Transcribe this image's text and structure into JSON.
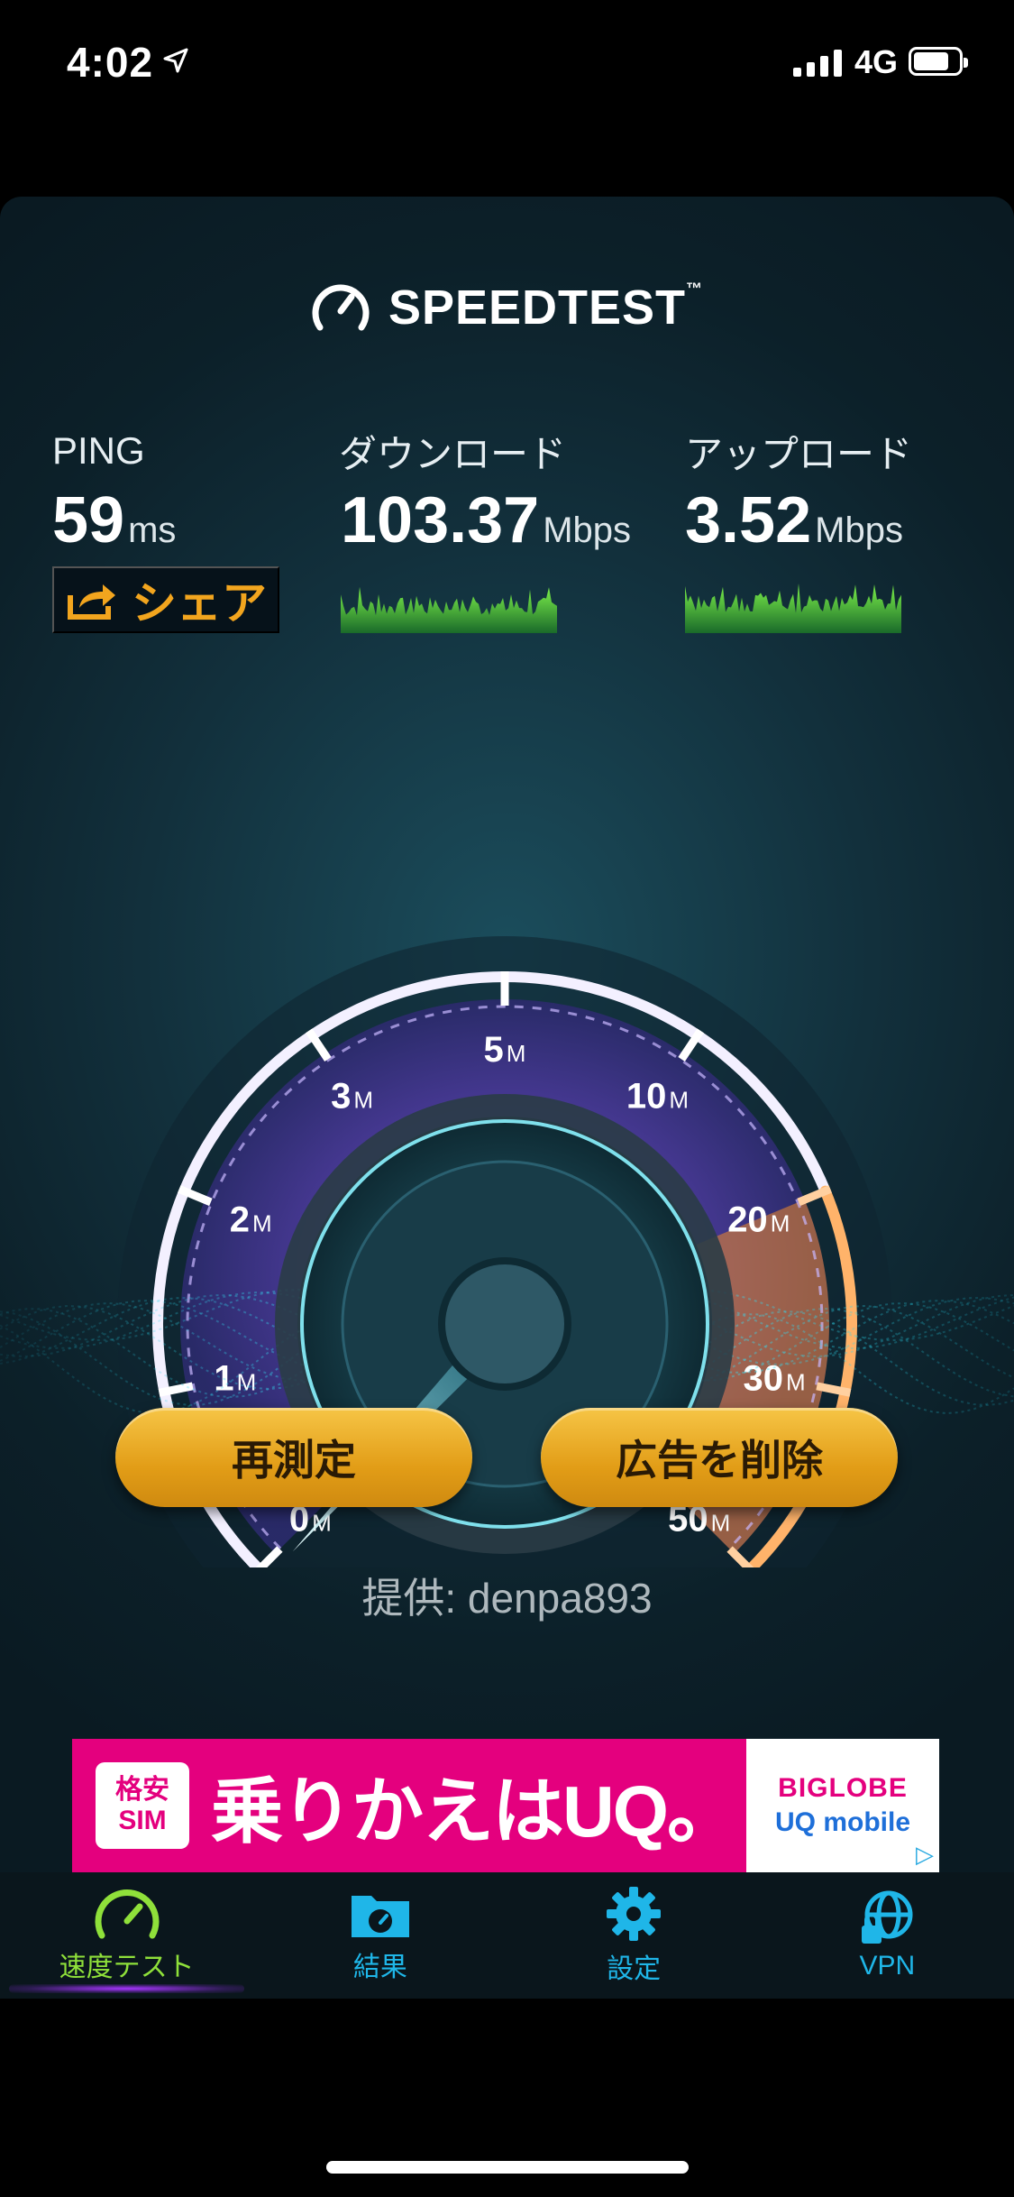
{
  "status_bar": {
    "time": "4:02",
    "network": "4G"
  },
  "app": {
    "brand": "SPEEDTEST",
    "trademark": "™"
  },
  "metrics": {
    "ping": {
      "label": "PING",
      "value": "59",
      "unit": "ms"
    },
    "download": {
      "label": "ダウンロード",
      "value": "103.37",
      "unit": "Mbps"
    },
    "upload": {
      "label": "アップロード",
      "value": "3.52",
      "unit": "Mbps"
    }
  },
  "share_label": "シェア",
  "gauge": {
    "ticks": [
      {
        "num": "0",
        "unit": "M"
      },
      {
        "num": "1",
        "unit": "M"
      },
      {
        "num": "2",
        "unit": "M"
      },
      {
        "num": "3",
        "unit": "M"
      },
      {
        "num": "5",
        "unit": "M"
      },
      {
        "num": "10",
        "unit": "M"
      },
      {
        "num": "20",
        "unit": "M"
      },
      {
        "num": "30",
        "unit": "M"
      },
      {
        "num": "50",
        "unit": "M"
      }
    ],
    "needle_value_mbps": 0,
    "colors": {
      "arc_start": "#3a6cf0",
      "arc_mid": "#8e4fe8",
      "arc_end": "#f08a2a",
      "needle": "#9ff4ff"
    }
  },
  "buttons": {
    "retest": "再測定",
    "remove_ads": "広告を削除"
  },
  "provider": "提供: denpa893",
  "ad": {
    "badge_line1": "格安",
    "badge_line2": "SIM",
    "headline": "乗りかえはUQ。",
    "brand_line1": "BIGLOBE",
    "brand_line2": "UQ mobile",
    "bg_color": "#e4007e"
  },
  "tabs": [
    {
      "label": "速度テスト",
      "icon": "speedometer-icon",
      "active": true
    },
    {
      "label": "結果",
      "icon": "results-folder-icon",
      "active": false
    },
    {
      "label": "設定",
      "icon": "gear-icon",
      "active": false
    },
    {
      "label": "VPN",
      "icon": "globe-lock-icon",
      "active": false
    }
  ]
}
